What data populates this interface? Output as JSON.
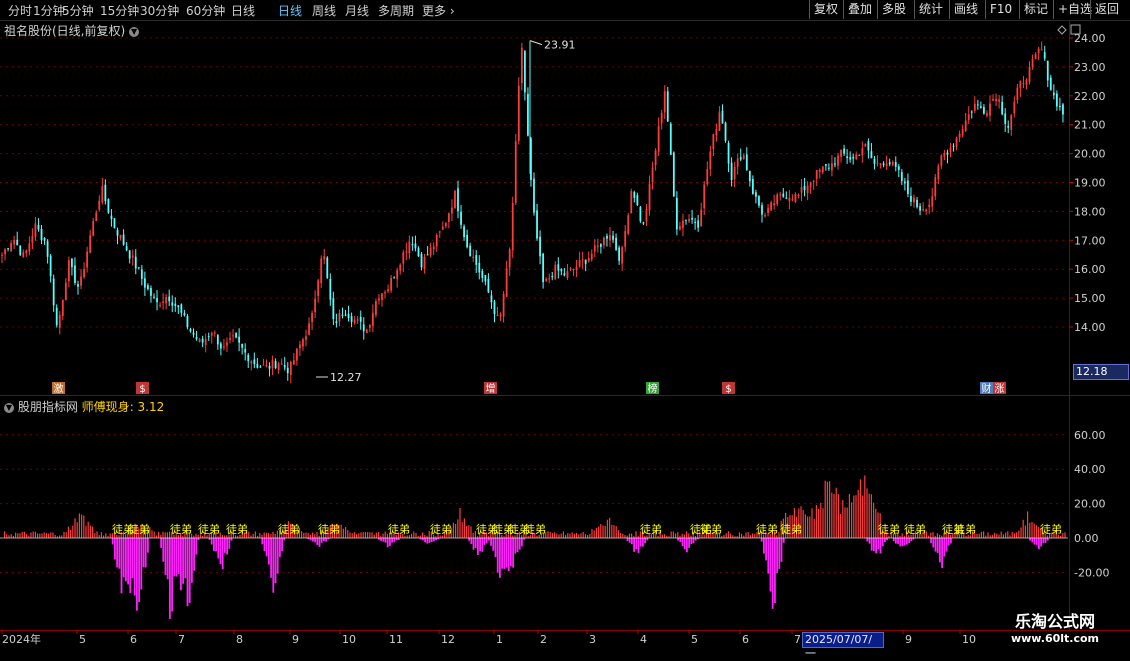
{
  "toolbar": {
    "periods": [
      {
        "label": "分时"
      },
      {
        "label": "1分钟"
      },
      {
        "label": "5分钟"
      },
      {
        "label": "15分钟"
      },
      {
        "label": "30分钟"
      },
      {
        "label": "60分钟"
      },
      {
        "label": "日线",
        "active": true
      },
      {
        "label": "周线"
      },
      {
        "label": "月线"
      },
      {
        "label": "多周期"
      },
      {
        "label": "更多"
      }
    ],
    "actions": [
      {
        "label": "复权"
      },
      {
        "label": "叠加"
      },
      {
        "label": "多股"
      },
      {
        "label": "统计"
      },
      {
        "label": "画线"
      },
      {
        "label": "F10"
      },
      {
        "label": "标记"
      },
      {
        "label": "+自选"
      },
      {
        "label": "返回"
      }
    ]
  },
  "stock": {
    "title": "祖名股份(日线,前复权)"
  },
  "price_axis": {
    "ticks": [
      "24.00",
      "23.00",
      "22.00",
      "21.00",
      "20.00",
      "19.00",
      "18.00",
      "17.00",
      "16.00",
      "15.00",
      "14.00"
    ]
  },
  "price_marks": {
    "high": "23.91",
    "low": "12.27",
    "last": "12.18"
  },
  "event_badges": [
    {
      "text": "激"
    },
    {
      "text": "$"
    },
    {
      "text": "增"
    },
    {
      "text": "榜"
    },
    {
      "text": "$"
    },
    {
      "text": "财"
    },
    {
      "text": "涨"
    }
  ],
  "indicator": {
    "source": "股朋指标网",
    "name": "师傅现身",
    "value": "3.12"
  },
  "indicator_axis": {
    "ticks": [
      "60.00",
      "40.00",
      "20.00",
      "0.00",
      "-20.00"
    ]
  },
  "signal_label": "徒弟",
  "time_axis": {
    "labels": [
      "2024年",
      "5",
      "6",
      "7",
      "8",
      "9",
      "10",
      "11",
      "12",
      "1",
      "2",
      "3",
      "4",
      "5",
      "6",
      "7",
      "9",
      "10"
    ]
  },
  "crosshair_date": "2025/07/07/一",
  "watermark": {
    "title": "乐淘公式网",
    "url": "www.60lt.com"
  },
  "colors": {
    "up": "#ff3c3c",
    "down": "#54ffff",
    "magenta": "#ff22ff",
    "signal": "#ffff00",
    "grid": "#6e0000"
  },
  "chart_data": {
    "type": "candlestick",
    "ylim": [
      12,
      24.3
    ],
    "close_path": [
      16.5,
      17.1,
      16.4,
      17.5,
      16.9,
      13.9,
      16.2,
      15.3,
      17.2,
      18.8,
      17.6,
      16.9,
      16.2,
      15.4,
      14.8,
      15.1,
      14.6,
      13.9,
      13.4,
      13.9,
      13.2,
      13.6,
      13.1,
      12.7,
      12.6,
      12.8,
      12.5,
      13.4,
      14.2,
      16.8,
      14.1,
      14.6,
      14.2,
      13.9,
      15.1,
      15.4,
      16.3,
      17.1,
      16.2,
      16.8,
      17.5,
      18.6,
      16.9,
      16.1,
      15.2,
      14.1,
      16.8,
      23.9,
      18.2,
      15.4,
      16.0,
      15.8,
      16.1,
      16.4,
      16.8,
      17.3,
      16.3,
      18.9,
      17.4,
      19.8,
      22.3,
      17.5,
      17.8,
      17.6,
      19.9,
      21.6,
      19.2,
      20.1,
      18.6,
      17.8,
      18.4,
      18.6,
      18.5,
      19.0,
      19.4,
      19.6,
      20.0,
      19.8,
      20.3,
      19.6,
      19.8,
      19.4,
      18.6,
      18.1,
      18.3,
      19.9,
      20.3,
      21.0,
      21.7,
      21.5,
      22.1,
      20.9,
      22.3,
      22.9,
      23.7,
      22.1,
      21.4
    ]
  }
}
